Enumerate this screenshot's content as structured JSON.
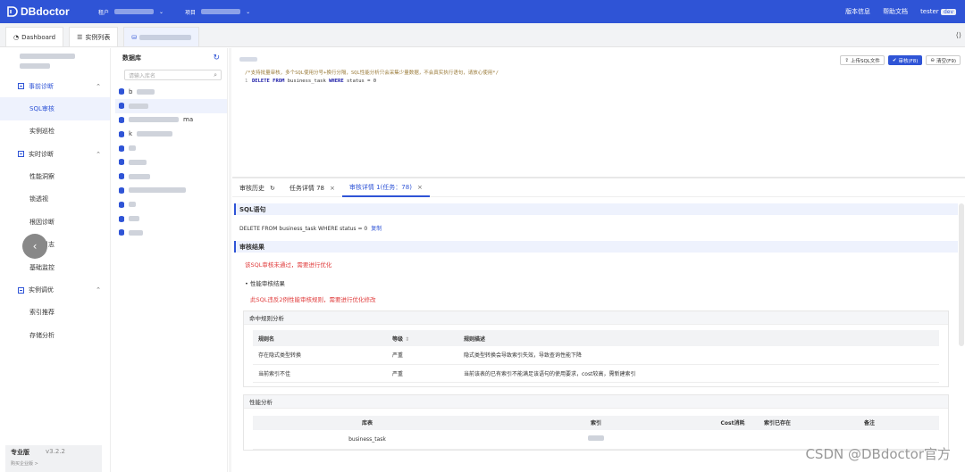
{
  "topbar": {
    "brand": "DBdoctor",
    "tenant_label": "租户",
    "project_label": "项目",
    "version_info": "版本信息",
    "help_docs": "帮助文档",
    "user": "tester",
    "user_tag": "dev"
  },
  "tabs": [
    {
      "label": "Dashboard"
    },
    {
      "label": "实例列表"
    }
  ],
  "sidebar": {
    "groups": [
      {
        "label": "事前诊断",
        "items": [
          "SQL审核",
          "实例巡检"
        ]
      },
      {
        "label": "实时诊断",
        "items": [
          "性能洞察",
          "锁透视",
          "根因诊断",
          "审计日志",
          "基础监控"
        ]
      },
      {
        "label": "实例调优",
        "items": [
          "索引推荐",
          "存储分析"
        ]
      }
    ],
    "active_item": "SQL审核",
    "edition": "专业版",
    "version": "v3.2.2",
    "edition_note": "购买企业版 >"
  },
  "db_panel": {
    "title": "数据库",
    "search_placeholder": "请输入库名",
    "items": [
      "b",
      "",
      "ma",
      "k",
      "",
      "",
      "",
      "",
      "",
      "",
      ""
    ]
  },
  "editor": {
    "upload_btn": "上传SQL文件",
    "audit_btn": "审核(F8)",
    "clear_btn": "清空(F9)",
    "comment": "/*支持批量审核，多个SQL使用分号+换行分隔，SQL性能分析只会采集少量数据，不会真实执行语句，请放心使用*/",
    "line_no": "1",
    "kw1": "DELETE FROM",
    "table": " business_task ",
    "kw2": "WHERE",
    "cond": " status = 0"
  },
  "bottom_tabs": [
    {
      "label": "审核历史"
    },
    {
      "label": "任务详情 78"
    },
    {
      "label": "审核详情 1(任务：78)"
    }
  ],
  "results": {
    "sql_section": "SQL语句",
    "sql_text": "DELETE FROM  business_task WHERE status = 0",
    "copy": "复制",
    "audit_section": "审核结果",
    "fail_msg": "该SQL审核未通过，需要进行优化",
    "perf_title": "性能审核结果",
    "perf_warn": "此SQL违反2例性能审核规则，需要进行优化修改",
    "hit_rules_title": "命中规则分析",
    "rules_headers": [
      "规则名",
      "等级",
      "规则描述"
    ],
    "rules": [
      [
        "存在隐式类型转换",
        "严重",
        "隐式类型转换会导致索引失效，导致查询性能下降"
      ],
      [
        "当前索引不佳",
        "严重",
        "当前该表的已有索引不能满足该语句的使用要求，cost较高，需新建索引"
      ]
    ],
    "perf_analysis_title": "性能分析",
    "perf_headers": [
      "库表",
      "索引",
      "Cost消耗",
      "索引已存在",
      "备注"
    ],
    "perf_rows": [
      [
        "business_task",
        "",
        "",
        "",
        ""
      ]
    ]
  },
  "watermark": "CSDN @DBdoctor官方"
}
